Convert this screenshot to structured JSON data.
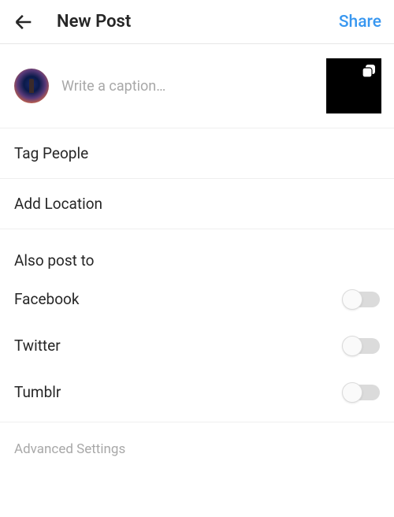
{
  "header": {
    "title": "New Post",
    "share_label": "Share"
  },
  "compose": {
    "caption_placeholder": "Write a caption…"
  },
  "rows": {
    "tag_people": "Tag People",
    "add_location": "Add Location"
  },
  "share_section": {
    "title": "Also post to",
    "items": [
      {
        "label": "Facebook",
        "on": false
      },
      {
        "label": "Twitter",
        "on": false
      },
      {
        "label": "Tumblr",
        "on": false
      }
    ]
  },
  "advanced_label": "Advanced Settings"
}
